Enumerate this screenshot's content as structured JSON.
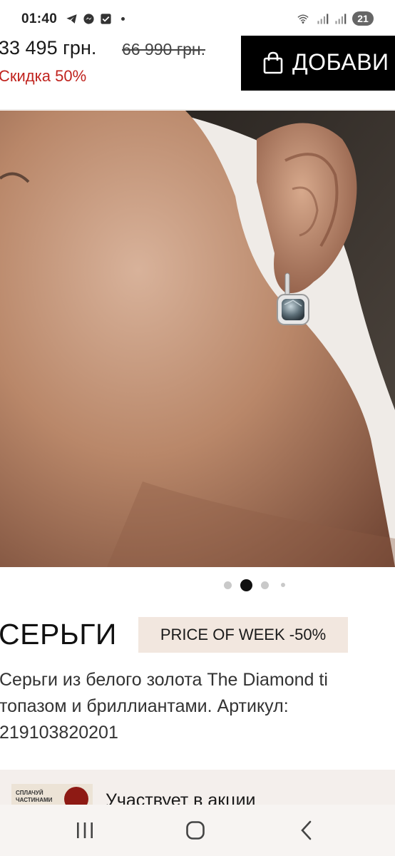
{
  "status_bar": {
    "time": "01:40",
    "notification_icons": [
      "telegram-icon",
      "messenger-icon",
      "checkbox-icon",
      "dot-icon"
    ],
    "system_icons": [
      "wifi-icon",
      "signal-icon",
      "signal-icon"
    ],
    "battery_level": "21"
  },
  "price_bar": {
    "current_price": "33 495 грн.",
    "old_price": "66 990 грн.",
    "discount_label": "Скидка 50%",
    "add_to_cart_label": "ДОБАВИ",
    "add_to_cart_icon": "shopping-bag-icon"
  },
  "product": {
    "image_alt": "earring-photo",
    "carousel": {
      "total_slides": 4,
      "active_index": 1
    },
    "title": "СЕРЬГИ",
    "badge": "PRICE OF WEEK -50%",
    "description_lines": [
      "Серьги из белого золота The Diamond ti",
      "топазом и бриллиантами. Артикул:",
      "219103820201"
    ]
  },
  "promo": {
    "thumb_text": "СПЛАЧУЙ ЧАСТИНАМИ",
    "title": "Участвует в акции"
  },
  "nav_bar": {
    "buttons": [
      "recent-apps-icon",
      "home-icon",
      "back-icon"
    ]
  },
  "colors": {
    "discount": "#c0231e",
    "button_bg": "#000000",
    "badge_bg": "#f2e7df",
    "promo_bg": "#f4efec"
  }
}
